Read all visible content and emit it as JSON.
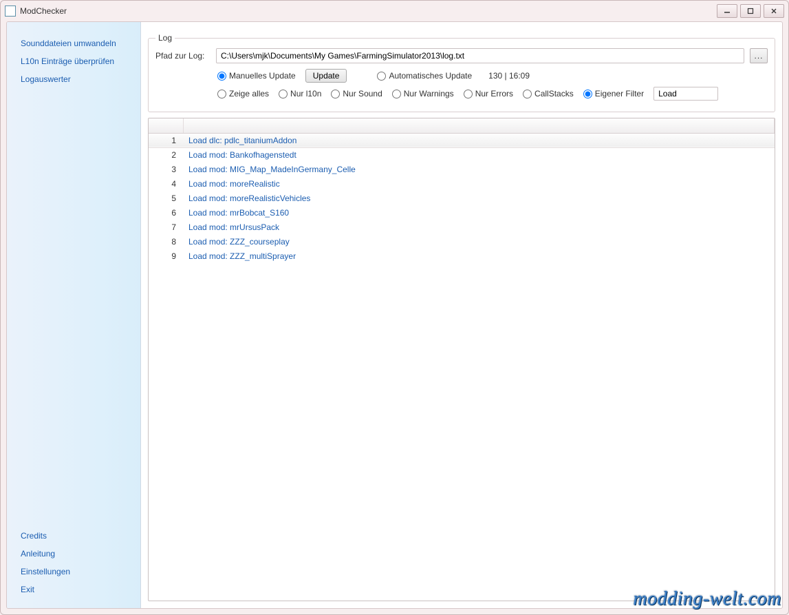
{
  "window": {
    "title": "ModChecker"
  },
  "sidebar": {
    "top": [
      {
        "label": "Sounddateien umwandeln"
      },
      {
        "label": "L10n Einträge überprüfen"
      },
      {
        "label": "Logauswerter"
      }
    ],
    "bottom": [
      {
        "label": "Credits"
      },
      {
        "label": "Anleitung"
      },
      {
        "label": "Einstellungen"
      },
      {
        "label": "Exit"
      }
    ]
  },
  "log_group": {
    "legend": "Log",
    "path_label": "Pfad zur Log:",
    "path_value": "C:\\Users\\mjk\\Documents\\My Games\\FarmingSimulator2013\\log.txt",
    "browse_label": "...",
    "update_mode": {
      "manual": "Manuelles Update",
      "auto": "Automatisches Update"
    },
    "update_button": "Update",
    "status": "130 | 16:09",
    "filters": {
      "all": "Zeige alles",
      "l10n": "Nur l10n",
      "sound": "Nur Sound",
      "warnings": "Nur Warnings",
      "errors": "Nur Errors",
      "callstacks": "CallStacks",
      "custom": "Eigener Filter"
    },
    "filter_value": "Load"
  },
  "rows": [
    {
      "n": "1",
      "msg": "Load dlc: pdlc_titaniumAddon"
    },
    {
      "n": "2",
      "msg": "Load mod: Bankofhagenstedt"
    },
    {
      "n": "3",
      "msg": "Load mod: MIG_Map_MadeInGermany_Celle"
    },
    {
      "n": "4",
      "msg": "Load mod: moreRealistic"
    },
    {
      "n": "5",
      "msg": "Load mod: moreRealisticVehicles"
    },
    {
      "n": "6",
      "msg": "Load mod: mrBobcat_S160"
    },
    {
      "n": "7",
      "msg": "Load mod: mrUrsusPack"
    },
    {
      "n": "8",
      "msg": "Load mod: ZZZ_courseplay"
    },
    {
      "n": "9",
      "msg": "Load mod: ZZZ_multiSprayer"
    }
  ],
  "watermark": "modding-welt.com"
}
